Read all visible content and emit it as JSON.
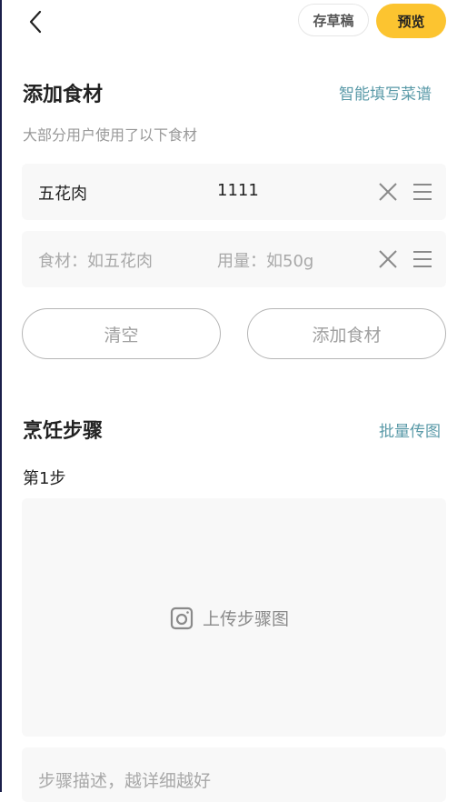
{
  "header": {
    "back_icon": "chevron-left-icon",
    "draft_label": "存草稿",
    "preview_label": "预览",
    "accent_color": "#fcc430"
  },
  "ingredients": {
    "title": "添加食材",
    "smart_fill_link": "智能填写菜谱",
    "subtitle": "大部分用户使用了以下食材",
    "rows": [
      {
        "name": "五花肉",
        "quantity": "1111",
        "name_placeholder": "",
        "quantity_placeholder": ""
      },
      {
        "name": "",
        "quantity": "",
        "name_placeholder": "食材：如五花肉",
        "quantity_placeholder": "用量：如50g"
      }
    ],
    "clear_label": "清空",
    "add_label": "添加食材"
  },
  "steps": {
    "title": "烹饪步骤",
    "batch_upload_link": "批量传图",
    "step_label": "第1步",
    "upload_label": "上传步骤图",
    "description_placeholder": "步骤描述，越详细越好"
  },
  "link_color": "#5a9aa8"
}
